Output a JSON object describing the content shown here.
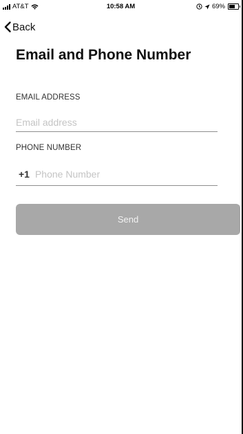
{
  "status_bar": {
    "carrier": "AT&T",
    "time": "10:58 AM",
    "battery_percent": "69%",
    "battery_level": 0.69,
    "icons": [
      "signal-bars-icon",
      "wifi-icon",
      "location-lock-icon",
      "location-arrow-icon",
      "battery-icon"
    ]
  },
  "nav": {
    "back_label": "Back",
    "back_icon": "chevron-left-icon"
  },
  "page": {
    "title": "Email and Phone Number"
  },
  "form": {
    "email": {
      "label": "EMAIL ADDRESS",
      "value": "",
      "placeholder": "Email address"
    },
    "phone": {
      "label": "PHONE NUMBER",
      "country_code": "+1",
      "value": "",
      "placeholder": "Phone Number"
    },
    "send_label": "Send"
  },
  "colors": {
    "button_background": "#a8a8a8",
    "button_text": "#f2f2f2",
    "placeholder": "#c4c4c4",
    "underline": "#8e8e8e"
  }
}
